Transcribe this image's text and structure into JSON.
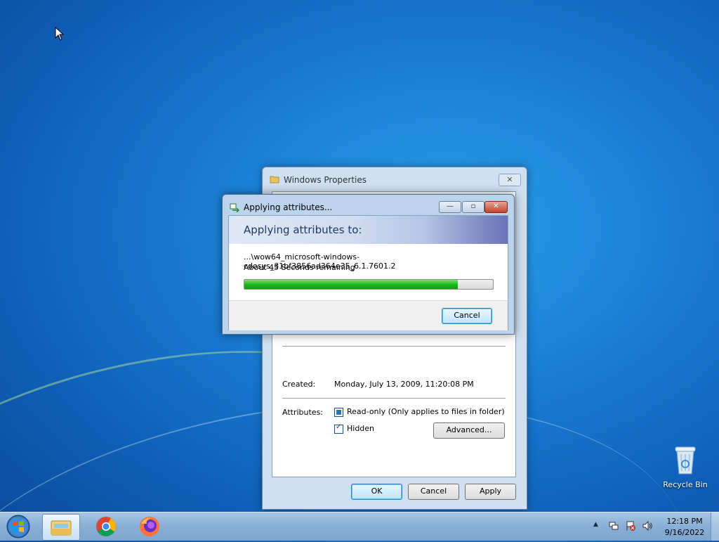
{
  "desktop": {
    "recycle_bin_label": "Recycle Bin"
  },
  "properties_window": {
    "title": "Windows Properties",
    "close_label": "✕",
    "created_label": "Created:",
    "created_value": "Monday, July 13, 2009, 11:20:08 PM",
    "attributes_label": "Attributes:",
    "readonly_label": "Read-only (Only applies to files in folder)",
    "readonly_state": "indeterminate",
    "hidden_label": "Hidden",
    "hidden_state": "checked",
    "advanced_label": "Advanced...",
    "ok_label": "OK",
    "cancel_label": "Cancel",
    "apply_label": "Apply"
  },
  "progress_dialog": {
    "title": "Applying attributes...",
    "heading": "Applying attributes to:",
    "path": "...\\wow64_microsoft-windows-cdosys_31bf3856ad364e35_6.1.7601.2",
    "time_remaining": "About 45 Seconds remaining",
    "progress_fraction": 0.86,
    "cancel_label": "Cancel",
    "minimize_label": "—",
    "restore_label": "▫",
    "close_label": "✕"
  },
  "taskbar": {
    "items": [
      "Windows Explorer",
      "Google Chrome",
      "Firefox"
    ],
    "tray_chevron": "▲",
    "time": "12:18 PM",
    "date": "9/16/2022"
  },
  "icons": {
    "start": "windows-orb",
    "explorer": "folder-library",
    "chrome": "chrome-logo",
    "firefox": "firefox-logo",
    "recycle_bin": "recycle-bin",
    "cursor": "arrow-pointer"
  },
  "colors": {
    "desktop_blue": "#1a7fd6",
    "progress_green": "#18b818",
    "taskbar": "#88aed6"
  }
}
